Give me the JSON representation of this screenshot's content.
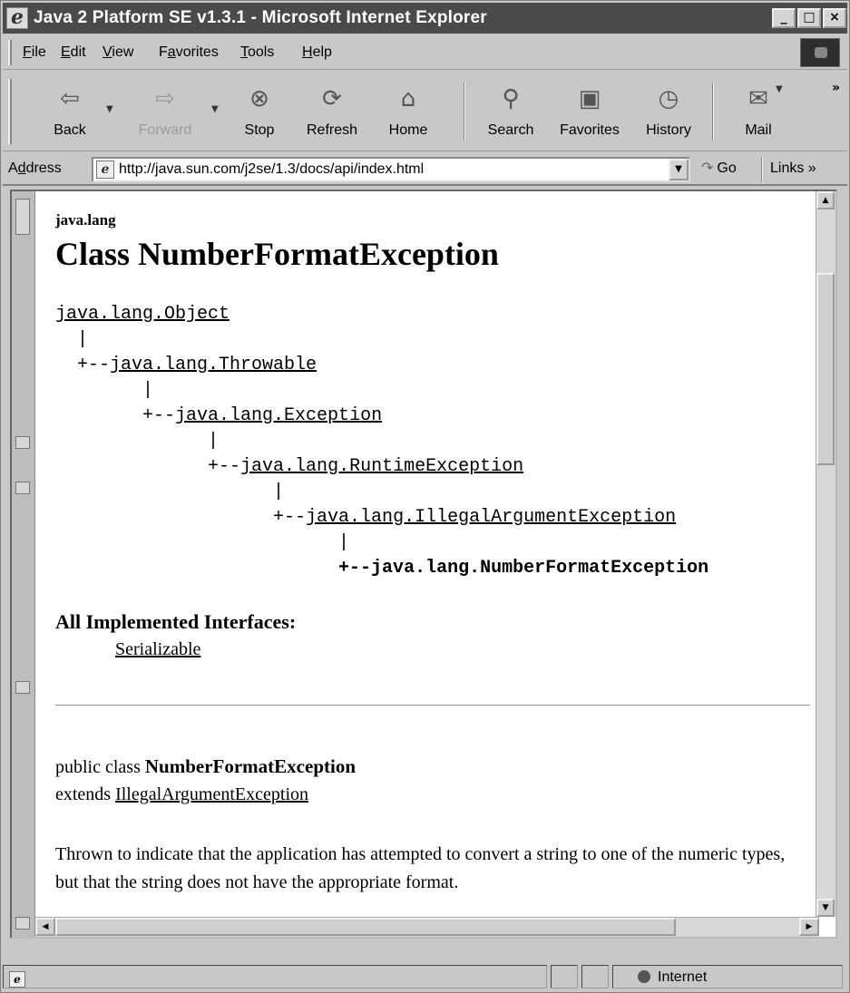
{
  "window": {
    "title": "Java 2 Platform SE v1.3.1 - Microsoft Internet Explorer",
    "controls": [
      "_",
      "□",
      "×"
    ]
  },
  "menu": {
    "items": [
      {
        "mn": "F",
        "rest": "ile"
      },
      {
        "mn": "E",
        "rest": "dit"
      },
      {
        "mn": "V",
        "rest": "iew"
      },
      {
        "pre": "F",
        "mn": "a",
        "rest": "vorites"
      },
      {
        "mn": "T",
        "rest": "ools"
      },
      {
        "mn": "H",
        "rest": "elp"
      }
    ]
  },
  "toolbar": {
    "back": "Back",
    "forward": "Forward",
    "stop": "Stop",
    "refresh": "Refresh",
    "home": "Home",
    "search": "Search",
    "favorites": "Favorites",
    "history": "History",
    "mail": "Mail",
    "more": "»",
    "icons": {
      "back": "back-arrow-icon",
      "forward": "forward-arrow-icon",
      "stop": "stop-icon",
      "refresh": "refresh-icon",
      "home": "home-icon",
      "search": "search-icon",
      "favorites": "favorites-folder-icon",
      "history": "history-icon",
      "mail": "mail-icon"
    }
  },
  "address": {
    "label_pre": "A",
    "label_mn": "d",
    "label_rest": "dress",
    "url": "http://java.sun.com/j2se/1.3/docs/api/index.html",
    "go": "Go",
    "links": "Links »"
  },
  "doc": {
    "package": "java.lang",
    "title": "Class NumberFormatException",
    "hierarchy": {
      "l0": "java.lang.Object",
      "p1": "  |",
      "l1_prefix": "  +--",
      "l1": "java.lang.Throwable",
      "p2": "        |",
      "l2_prefix": "        +--",
      "l2": "java.lang.Exception",
      "p3": "              |",
      "l3_prefix": "              +--",
      "l3": "java.lang.RuntimeException",
      "p4": "                    |",
      "l4_prefix": "                    +--",
      "l4": "java.lang.IllegalArgumentException",
      "p5": "                          |",
      "l5": "                          +--java.lang.NumberFormatException"
    },
    "implemented_heading": "All Implemented Interfaces:",
    "implemented_link": "Serializable",
    "decl_prefix": "public class ",
    "decl_name": "NumberFormatException",
    "extends_prefix": "extends ",
    "extends_link": "IllegalArgumentException",
    "description": "Thrown to indicate that the application has attempted to convert a string to one of the numeric types, but that the string does not have the appropriate format."
  },
  "status": {
    "zone": "Internet"
  }
}
